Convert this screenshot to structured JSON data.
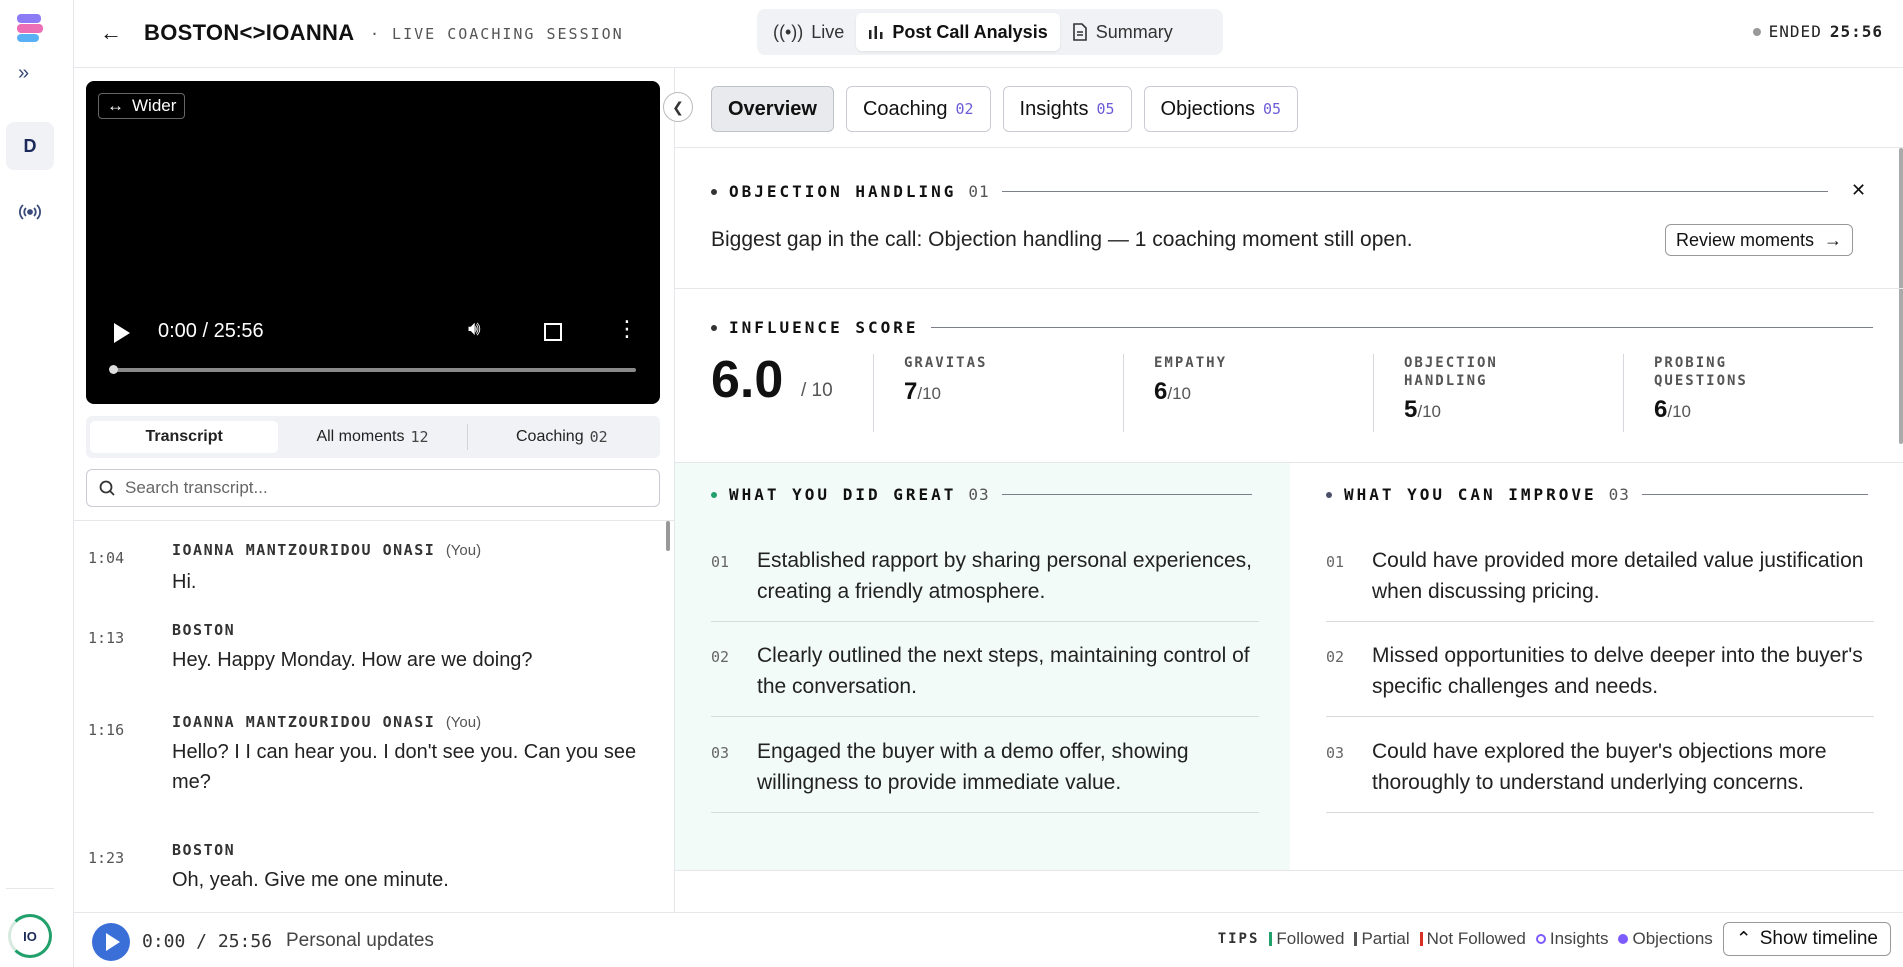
{
  "header": {
    "title": "BOSTON<>IOANNA",
    "subtitle": "· LIVE COACHING SESSION",
    "tabs": [
      {
        "label": "Live"
      },
      {
        "label": "Post Call Analysis"
      },
      {
        "label": "Summary"
      }
    ],
    "status": "ENDED",
    "duration": "25:56"
  },
  "rail": {
    "workspace_initial": "D",
    "avatar_initials": "IO"
  },
  "video": {
    "wider_label": "Wider",
    "time": "0:00 / 25:56"
  },
  "left_tabs": [
    {
      "label": "Transcript",
      "count": ""
    },
    {
      "label": "All moments",
      "count": "12"
    },
    {
      "label": "Coaching",
      "count": "02"
    }
  ],
  "search": {
    "placeholder": "Search transcript..."
  },
  "transcript": [
    {
      "time": "1:04",
      "speaker": "IOANNA MANTZOURIDOU ONASI",
      "you": "(You)",
      "text": "Hi."
    },
    {
      "time": "1:13",
      "speaker": "BOSTON",
      "you": "",
      "text": "Hey. Happy Monday. How are we doing?"
    },
    {
      "time": "1:16",
      "speaker": "IOANNA MANTZOURIDOU ONASI",
      "you": "(You)",
      "text": "Hello? I I can hear you. I don't see you. Can you see me?"
    },
    {
      "time": "1:23",
      "speaker": "BOSTON",
      "you": "",
      "text": "Oh, yeah. Give me one minute."
    }
  ],
  "bottom": {
    "time": "0:00 / 25:56",
    "topic": "Personal updates",
    "tips_label": "TIPS",
    "legend": [
      {
        "label": "Followed",
        "color": "#22a06b"
      },
      {
        "label": "Partial",
        "color": "#555555"
      },
      {
        "label": "Not Followed",
        "color": "#d93025"
      },
      {
        "label": "Insights",
        "color": "#7c5cff"
      },
      {
        "label": "Objections",
        "color": "#7c5cff"
      }
    ],
    "show_timeline": "Show timeline"
  },
  "right_tabs": [
    {
      "label": "Overview",
      "count": ""
    },
    {
      "label": "Coaching",
      "count": "02"
    },
    {
      "label": "Insights",
      "count": "05"
    },
    {
      "label": "Objections",
      "count": "05"
    }
  ],
  "objection": {
    "label": "OBJECTION HANDLING",
    "count": "01",
    "text": "Biggest gap in the call: Objection handling — 1 coaching moment still open.",
    "review": "Review moments"
  },
  "influence": {
    "label": "INFLUENCE SCORE",
    "score": "6.0",
    "denom": "/ 10",
    "metrics": [
      {
        "label": "GRAVITAS",
        "value": "7",
        "den": "/10"
      },
      {
        "label": "EMPATHY",
        "value": "6",
        "den": "/10"
      },
      {
        "label": "OBJECTION HANDLING",
        "value": "5",
        "den": "/10"
      },
      {
        "label": "PROBING QUESTIONS",
        "value": "6",
        "den": "/10"
      }
    ]
  },
  "great": {
    "label": "WHAT YOU DID GREAT",
    "count": "03",
    "items": [
      {
        "num": "01",
        "text": "Established rapport by sharing personal experiences, creating a friendly atmosphere."
      },
      {
        "num": "02",
        "text": "Clearly outlined the next steps, maintaining control of the conversation."
      },
      {
        "num": "03",
        "text": "Engaged the buyer with a demo offer, showing willingness to provide immediate value."
      }
    ]
  },
  "improve": {
    "label": "WHAT YOU CAN IMPROVE",
    "count": "03",
    "items": [
      {
        "num": "01",
        "text": "Could have provided more detailed value justification when discussing pricing."
      },
      {
        "num": "02",
        "text": "Missed opportunities to delve deeper into the buyer's specific challenges and needs."
      },
      {
        "num": "03",
        "text": "Could have explored the buyer's objections more thoroughly to understand underlying concerns."
      }
    ]
  }
}
